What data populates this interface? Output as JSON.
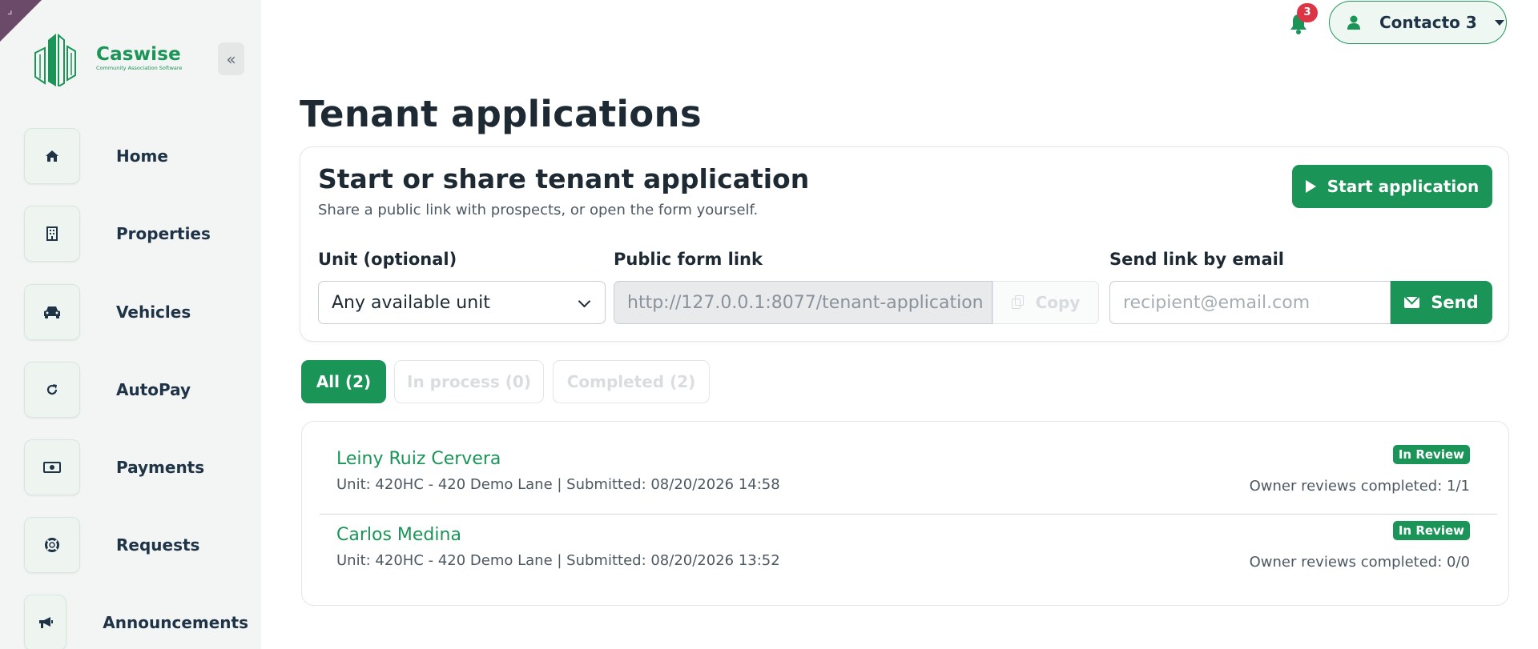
{
  "sidebar": {
    "brand_name": "Caswise",
    "brand_tagline": "Community Association Software",
    "collapse_label": "«",
    "items": [
      {
        "label": "Home",
        "icon": "home-icon"
      },
      {
        "label": "Properties",
        "icon": "building-icon"
      },
      {
        "label": "Vehicles",
        "icon": "car-icon"
      },
      {
        "label": "AutoPay",
        "icon": "refresh-icon"
      },
      {
        "label": "Payments",
        "icon": "money-icon"
      },
      {
        "label": "Requests",
        "icon": "lifebuoy-icon"
      },
      {
        "label": "Announcements",
        "icon": "megaphone-icon"
      }
    ]
  },
  "header": {
    "notification_count": "3",
    "user_name": "Contacto 3"
  },
  "page": {
    "title": "Tenant applications"
  },
  "share": {
    "title": "Start or share tenant application",
    "subtitle": "Share a public link with prospects, or open the form yourself.",
    "start_button": "Start application",
    "unit_label": "Unit (optional)",
    "unit_value": "Any available unit",
    "link_label": "Public form link",
    "link_value": "http://127.0.0.1:8077/tenant-application",
    "copy_button": "Copy",
    "email_label": "Send link by email",
    "email_placeholder": "recipient@email.com",
    "send_button": "Send"
  },
  "filters": [
    {
      "label": "All (2)",
      "active": true
    },
    {
      "label": "In process (0)",
      "active": false
    },
    {
      "label": "Completed (2)",
      "active": false
    }
  ],
  "applications": [
    {
      "name": "Leiny Ruiz Cervera",
      "meta": "Unit: 420HC - 420 Demo Lane | Submitted: 08/20/2026 14:58",
      "status": "In Review",
      "reviews": "Owner reviews completed: 1/1"
    },
    {
      "name": "Carlos Medina",
      "meta": "Unit: 420HC - 420 Demo Lane | Submitted: 08/20/2026 13:52",
      "status": "In Review",
      "reviews": "Owner reviews completed: 0/0"
    }
  ],
  "colors": {
    "brand": "#1a9457",
    "sidebar_bg": "#f3f4f4",
    "badge": "#dc3545",
    "corner": "#6b4968"
  }
}
